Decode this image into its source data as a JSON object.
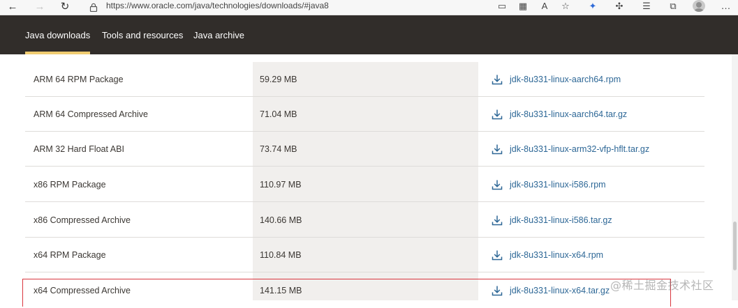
{
  "browser": {
    "url": "https://www.oracle.com/java/technologies/downloads/#java8",
    "back_glyph": "←",
    "forward_glyph": "→",
    "reload_glyph": "↻",
    "menu_glyph": "…",
    "toolbar_icons": [
      {
        "name": "app-available-icon",
        "glyph": "▭"
      },
      {
        "name": "grid-icon",
        "glyph": "▦"
      },
      {
        "name": "read-aloud-icon",
        "glyph": "A"
      },
      {
        "name": "favorite-add-icon",
        "glyph": "☆"
      },
      {
        "name": "extension-icon",
        "glyph": "✦"
      },
      {
        "name": "puzzle-icon",
        "glyph": "✣"
      },
      {
        "name": "favorites-icon",
        "glyph": "☰"
      },
      {
        "name": "collections-icon",
        "glyph": "⧉"
      }
    ]
  },
  "nav": {
    "tabs": [
      {
        "label": "Java downloads",
        "active": true
      },
      {
        "label": "Tools and resources",
        "active": false
      },
      {
        "label": "Java archive",
        "active": false
      }
    ]
  },
  "downloads": {
    "rows": [
      {
        "product": "ARM 64 RPM Package",
        "size": "59.29 MB",
        "file": "jdk-8u331-linux-aarch64.rpm"
      },
      {
        "product": "ARM 64 Compressed Archive",
        "size": "71.04 MB",
        "file": "jdk-8u331-linux-aarch64.tar.gz"
      },
      {
        "product": "ARM 32 Hard Float ABI",
        "size": "73.74 MB",
        "file": "jdk-8u331-linux-arm32-vfp-hflt.tar.gz"
      },
      {
        "product": "x86 RPM Package",
        "size": "110.97 MB",
        "file": "jdk-8u331-linux-i586.rpm"
      },
      {
        "product": "x86 Compressed Archive",
        "size": "140.66 MB",
        "file": "jdk-8u331-linux-i586.tar.gz"
      },
      {
        "product": "x64 RPM Package",
        "size": "110.84 MB",
        "file": "jdk-8u331-linux-x64.rpm"
      },
      {
        "product": "x64 Compressed Archive",
        "size": "141.15 MB",
        "file": "jdk-8u331-linux-x64.tar.gz",
        "highlighted": true
      }
    ]
  },
  "colors": {
    "nav_bg": "#312d2a",
    "nav_active_underline": "#f0cc71",
    "link": "#2d6796",
    "size_column_bg": "#f1efed",
    "highlight_border": "#d9363e"
  },
  "watermark": "@稀土掘金技术社区"
}
